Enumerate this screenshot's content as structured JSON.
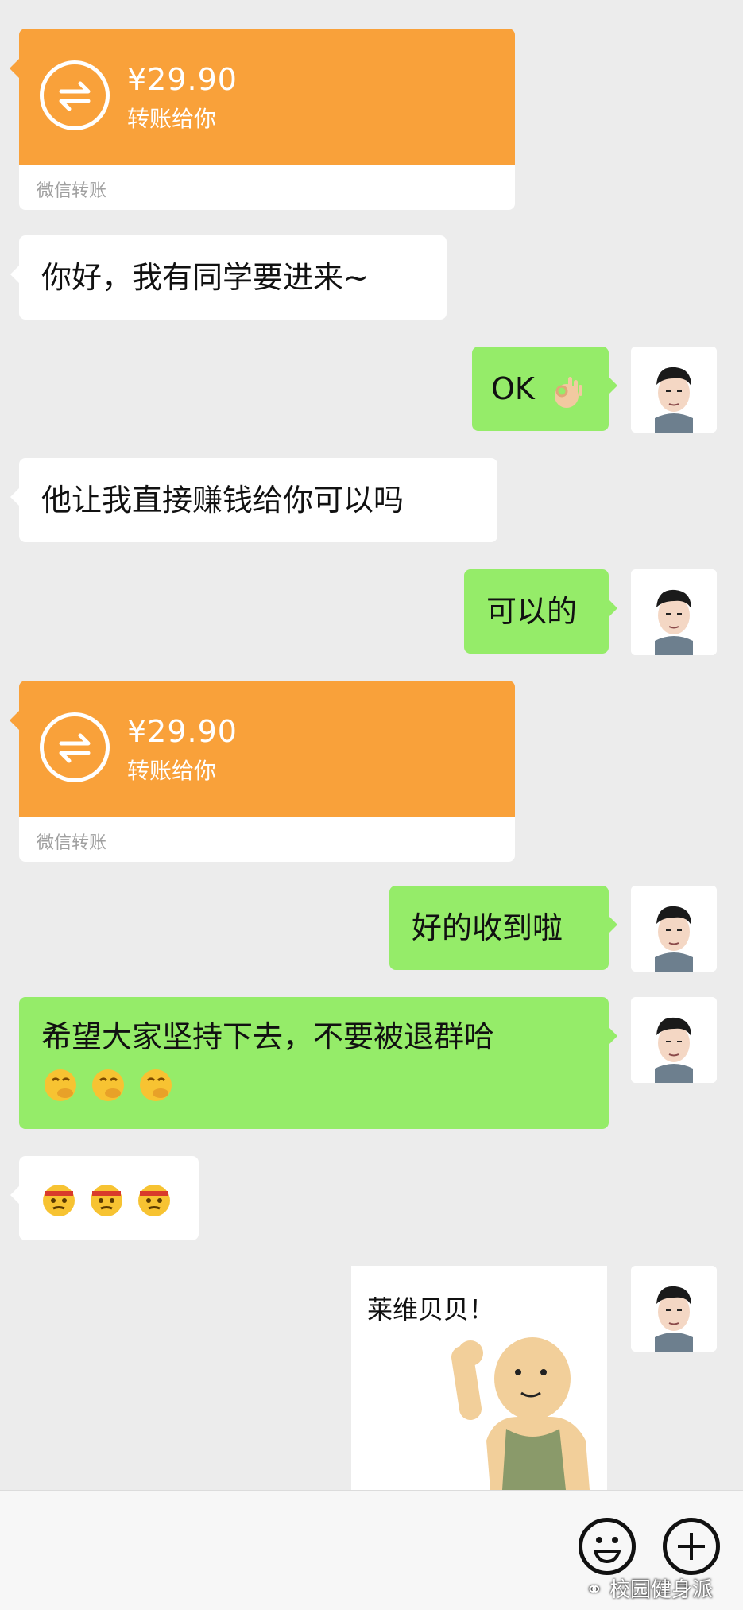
{
  "messages": {
    "transfer1": {
      "amount": "¥29.90",
      "desc": "转账给你",
      "source": "微信转账"
    },
    "m1": {
      "text": "你好，我有同学要进来~"
    },
    "m2": {
      "text": "OK"
    },
    "m3": {
      "text": "他让我直接赚钱给你可以吗"
    },
    "m4": {
      "text": "可以的"
    },
    "transfer2": {
      "amount": "¥29.90",
      "desc": "转账给你",
      "source": "微信转账"
    },
    "m5": {
      "text": "好的收到啦"
    },
    "m6": {
      "text": "希望大家坚持下去，不要被退群哈"
    },
    "sticker": {
      "text": "莱维贝贝！"
    }
  },
  "watermark": "校园健身派",
  "colors": {
    "background": "#ececec",
    "transfer_orange": "#f9a13a",
    "self_bubble_green": "#95ec69",
    "other_bubble_white": "#ffffff"
  },
  "icons": {
    "transfer": "transfer-arrows-icon",
    "ok_hand": "ok-hand-emoji",
    "face_hand": "thinking-face-emoji",
    "headband": "headband-face-emoji",
    "emoji_button": "smiley-icon",
    "plus_button": "plus-icon"
  }
}
